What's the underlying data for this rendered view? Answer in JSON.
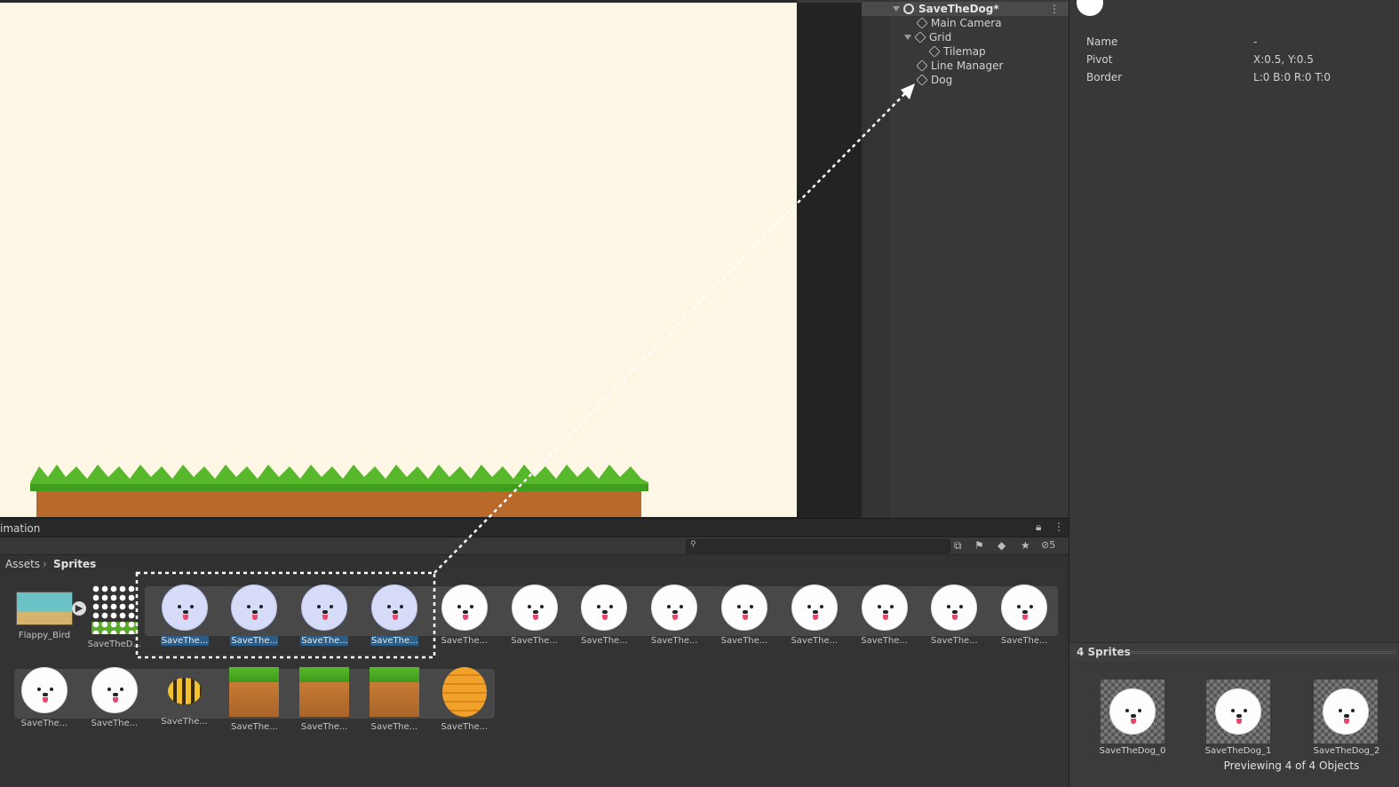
{
  "hierarchy": {
    "scene": "SaveTheDog*",
    "items": [
      "Main Camera",
      "Grid",
      "Tilemap",
      "Line Manager",
      "Dog"
    ]
  },
  "inspector": {
    "fields": [
      {
        "label": "Name",
        "value": "-"
      },
      {
        "label": "Pivot",
        "value": "X:0.5, Y:0.5"
      },
      {
        "label": "Border",
        "value": "L:0 B:0 R:0 T:0"
      }
    ],
    "preview_title": "4 Sprites",
    "preview_items": [
      "SaveTheDog_0",
      "SaveTheDog_1",
      "SaveTheDog_2"
    ],
    "preview_footer": "Previewing 4 of 4 Objects"
  },
  "project": {
    "tab": "imation",
    "hidden_count": "5",
    "breadcrumb": {
      "root": "Assets",
      "current": "Sprites"
    },
    "row1": [
      {
        "label": "Flappy_Bird",
        "kind": "scene"
      },
      {
        "label": "SaveTheD...",
        "kind": "sheet"
      },
      {
        "label": "SaveThe...",
        "kind": "dog-blue",
        "selected": true
      },
      {
        "label": "SaveThe...",
        "kind": "dog-blue",
        "selected": true
      },
      {
        "label": "SaveThe...",
        "kind": "dog-blue",
        "selected": true
      },
      {
        "label": "SaveThe...",
        "kind": "dog-blue",
        "selected": true
      },
      {
        "label": "SaveThe...",
        "kind": "dog"
      },
      {
        "label": "SaveThe...",
        "kind": "dog"
      },
      {
        "label": "SaveThe...",
        "kind": "dog"
      },
      {
        "label": "SaveThe...",
        "kind": "dog"
      },
      {
        "label": "SaveThe...",
        "kind": "dog"
      },
      {
        "label": "SaveThe...",
        "kind": "dog"
      },
      {
        "label": "SaveThe...",
        "kind": "dog"
      },
      {
        "label": "SaveThe...",
        "kind": "dog"
      },
      {
        "label": "SaveThe...",
        "kind": "dog"
      }
    ],
    "row2": [
      {
        "label": "SaveThe...",
        "kind": "dog"
      },
      {
        "label": "SaveThe...",
        "kind": "dog"
      },
      {
        "label": "SaveThe...",
        "kind": "bee"
      },
      {
        "label": "SaveThe...",
        "kind": "grass"
      },
      {
        "label": "SaveThe...",
        "kind": "grass"
      },
      {
        "label": "SaveThe...",
        "kind": "grass"
      },
      {
        "label": "SaveThe...",
        "kind": "hive"
      }
    ]
  }
}
